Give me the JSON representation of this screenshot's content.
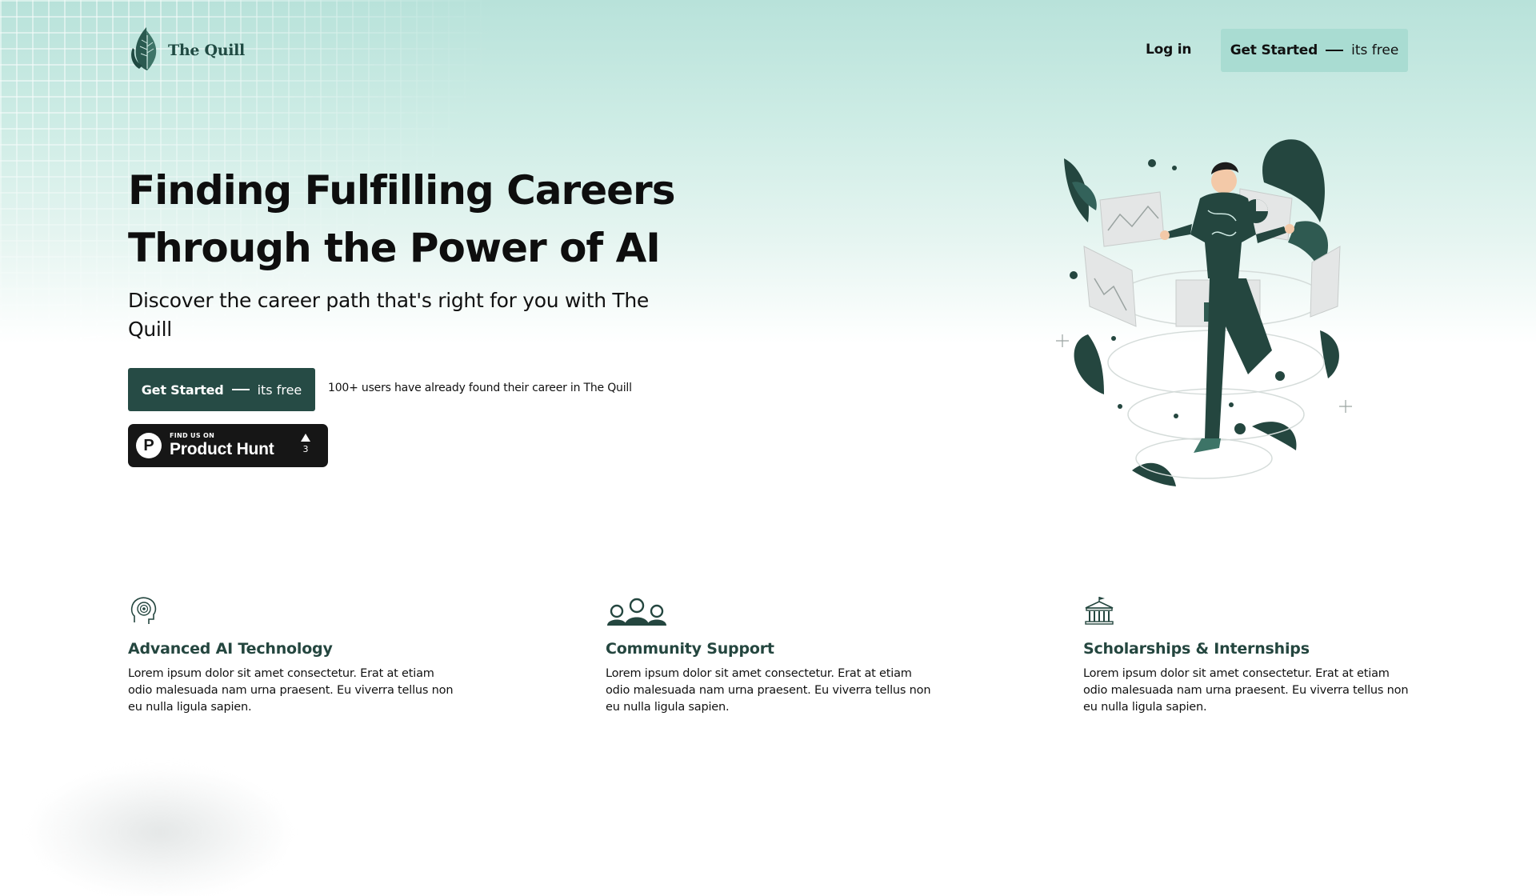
{
  "brand": {
    "name": "The Quill",
    "accent": "#264b45",
    "accent_light": "#a9dcd2",
    "heading_color": "#24463f"
  },
  "nav": {
    "login_label": "Log in",
    "cta_main": "Get Started",
    "cta_sub": "its free"
  },
  "hero": {
    "title_line1": "Finding Fulfilling Careers",
    "title_line2": "Through the Power of AI",
    "subtitle": "Discover the career path that's right for you with The Quill",
    "cta_main": "Get Started",
    "cta_sub": "its free",
    "users_note": "100+ users have already found their career in The Quill",
    "product_hunt": {
      "small": "FIND US ON",
      "big": "Product Hunt",
      "votes": "3",
      "icon": "product-hunt-p-icon"
    },
    "illustration": "person-with-floating-charts-illustration"
  },
  "features": [
    {
      "icon": "ai-head-icon",
      "title": "Advanced AI Technology",
      "text": "Lorem ipsum dolor sit amet consectetur. Erat at etiam odio malesuada nam urna praesent. Eu viverra tellus non eu nulla ligula sapien."
    },
    {
      "icon": "community-people-icon",
      "title": "Community Support",
      "text": "Lorem ipsum dolor sit amet consectetur. Erat at etiam odio malesuada nam urna praesent. Eu viverra tellus non eu nulla ligula sapien."
    },
    {
      "icon": "university-building-icon",
      "title": "Scholarships & Internships",
      "text": "Lorem ipsum dolor sit amet consectetur. Erat at etiam odio malesuada nam urna praesent. Eu viverra tellus non eu nulla ligula sapien."
    }
  ]
}
